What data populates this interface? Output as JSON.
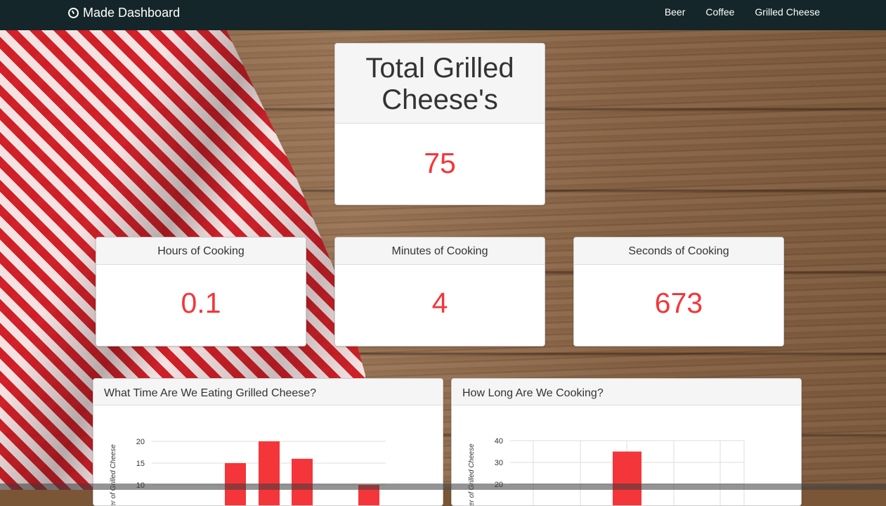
{
  "navbar": {
    "brand": "Made Dashboard",
    "brand_icon": "dashboard-gauge-icon",
    "links": [
      "Beer",
      "Coffee",
      "Grilled Cheese"
    ]
  },
  "colors": {
    "accent": "#f4363a",
    "navbar": "#15262a"
  },
  "total": {
    "title": "Total Grilled Cheese's",
    "value": "75"
  },
  "stats": {
    "hours": {
      "title": "Hours of Cooking",
      "value": "0.1"
    },
    "minutes": {
      "title": "Minutes of Cooking",
      "value": "4"
    },
    "seconds": {
      "title": "Seconds of Cooking",
      "value": "673"
    }
  },
  "charts": {
    "time": {
      "title": "What Time Are We Eating Grilled Cheese?"
    },
    "cook": {
      "title": "How Long Are We Cooking?"
    }
  },
  "chart_data": [
    {
      "type": "bar",
      "title": "What Time Are We Eating Grilled Cheese?",
      "ylabel": "Number of Grilled Cheese",
      "ylim": [
        0,
        20
      ],
      "yticks": [
        10,
        15,
        20
      ],
      "grid": true,
      "values": [
        15,
        20,
        16,
        10
      ]
    },
    {
      "type": "bar",
      "title": "How Long Are We Cooking?",
      "ylabel": "Number of Grilled Cheese",
      "ylim": [
        0,
        40
      ],
      "yticks": [
        20,
        30,
        40
      ],
      "grid": true,
      "values": [
        35
      ]
    }
  ]
}
